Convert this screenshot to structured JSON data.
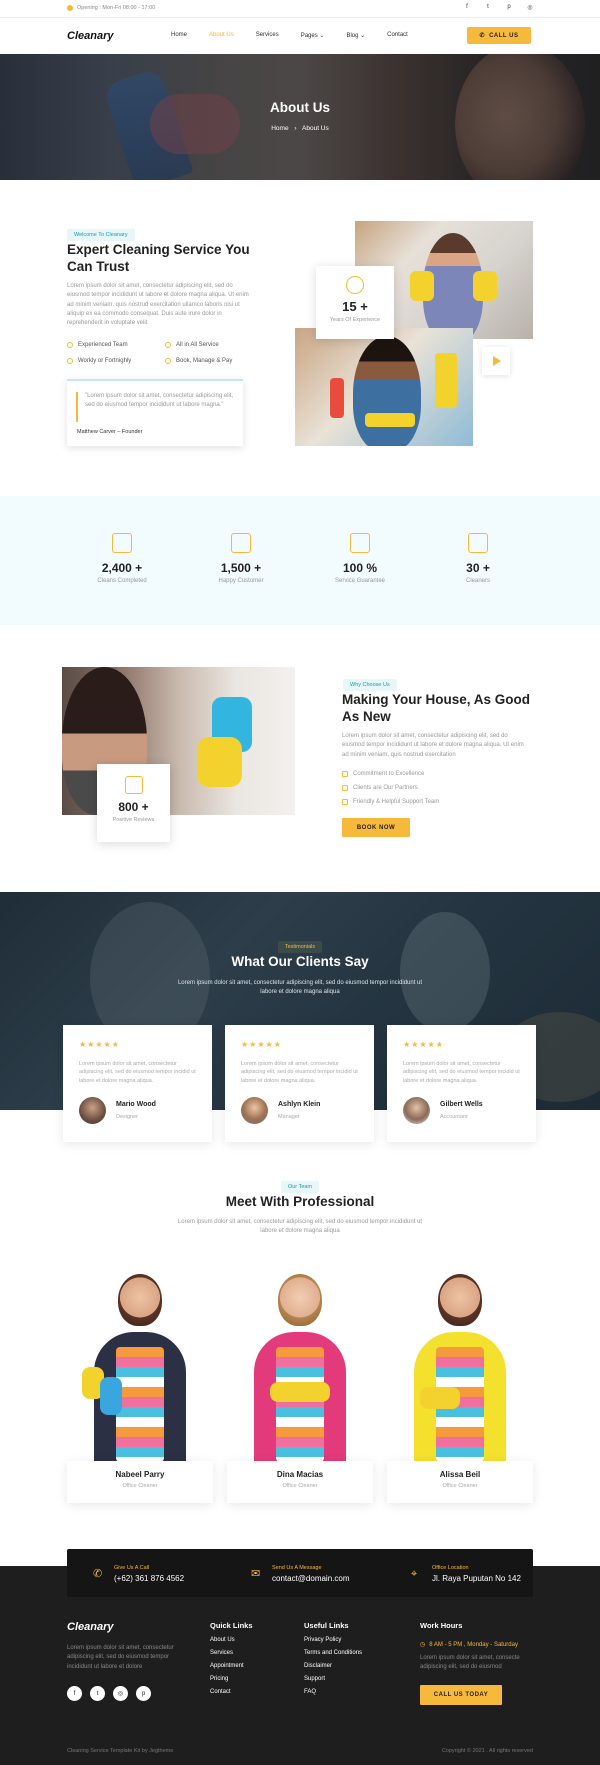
{
  "topbar": {
    "opening": "Opening : Mon-Fri 08:00 - 17:00",
    "socials": [
      "f",
      "t",
      "p",
      "◎"
    ]
  },
  "nav": {
    "logo": "Cleanary",
    "menu": [
      "Home",
      "About Us",
      "Services",
      "Pages ⌄",
      "Blog ⌄",
      "Contact"
    ],
    "call": "CALL US"
  },
  "hero": {
    "title": "About Us",
    "crumb_home": "Home",
    "crumb_sep": "›",
    "crumb_current": "About Us"
  },
  "about": {
    "tag": "Welcome To Cleanary",
    "title": "Expert Cleaning Service You Can Trust",
    "para": "Lorem ipsum dolor sit amet, consectetur adipiscing elit, sed do eiusmod tempor incididunt ut labore et dolore magna aliqua. Ut enim ad minim veniam, quis nostrud exercitation ullamco laboris nisi ut aliquip ex ea commodo consequat. Duis aute irure dolor in reprehenderit in voluptate velit",
    "features": [
      "Experienced Team",
      "All in All Service",
      "Workly or Fortnighly",
      "Book, Manage & Pay"
    ],
    "quote": "\"Lorem ipsum dolor sit amet, consectetur adipiscing elit, sed do eiusmod tempor incididunt ut labore magna.\"",
    "author": "Matthew Carver – Founder",
    "years_num": "15 +",
    "years_label": "Years Of Experience"
  },
  "stats": [
    {
      "num": "2,400 +",
      "label": "Cleans Completed"
    },
    {
      "num": "1,500 +",
      "label": "Happy Customer"
    },
    {
      "num": "100 %",
      "label": "Service Guarantee"
    },
    {
      "num": "30 +",
      "label": "Cleaners"
    }
  ],
  "why": {
    "tag": "Why Choose Us",
    "title": "Making Your House, As Good As New",
    "para": "Lorem ipsum dolor sit amet, consectetur adipiscing elit, sed do eiusmod tempor incididunt ut labore et dolore magna aliqua. Ut enim ad minim veniam, quis nostrud exercitation",
    "checks": [
      "Commitment to Excellence",
      "Clients are Our Partners",
      "Friendly & Helpful Support Team"
    ],
    "button": "BOOK NOW",
    "reviews_num": "800 +",
    "reviews_label": "Positive Reviews"
  },
  "testimonials": {
    "tag": "Testimonials",
    "title": "What Our Clients Say",
    "para": "Lorem ipsum dolor sit amet, consectetur adipiscing elit, sed do eiusmod tempor incididunt ut labore et dolore magna aliqua",
    "stars": "★★★★★",
    "items": [
      {
        "text": "Lorem ipsum dolor sit amet, consectetur adipiscing elit, sed do eiusmod tempor incidid ut labore et dolore magna aliqua.",
        "name": "Mario Wood",
        "role": "Designer"
      },
      {
        "text": "Lorem ipsum dolor sit amet, consectetur adipiscing elit, sed do eiusmod tempor incidid ut labore et dolore magna aliqua.",
        "name": "Ashlyn Klein",
        "role": "Manager"
      },
      {
        "text": "Lorem ipsum dolor sit amet, consectetur adipiscing elit, sed do eiusmod tempor incidid ut labore et dolore magna aliqua.",
        "name": "Gilbert Wells",
        "role": "Accountant"
      }
    ]
  },
  "team": {
    "tag": "Our Team",
    "title": "Meet With Professional",
    "para": "Lorem ipsum dolor sit amet, consectetur adipiscing elit, sed do eiusmod tempor incididunt ut labore et dolore magna aliqua",
    "members": [
      {
        "name": "Nabeel Parry",
        "role": "Office Cleaner"
      },
      {
        "name": "Dina Macias",
        "role": "Office Cleaner"
      },
      {
        "name": "Alissa Beil",
        "role": "Office Cleaner"
      }
    ]
  },
  "contact": [
    {
      "label": "Give Us A Call",
      "value": "(+62) 361 876 4562"
    },
    {
      "label": "Send Us A Message",
      "value": "contact@domain.com"
    },
    {
      "label": "Office Location",
      "value": "Jl. Raya Puputan No 142"
    }
  ],
  "footer": {
    "logo": "Cleanary",
    "para": "Lorem ipsum dolor sit amet, consectetur adipiscing elit, sed do eiusmod tempor incididunt ut labore et dolore",
    "quick_title": "Quick Links",
    "quick": [
      "About Us",
      "Services",
      "Appointment",
      "Pricing",
      "Contact"
    ],
    "useful_title": "Useful Links",
    "useful": [
      "Privacy Policy",
      "Terms and Conditions",
      "Disclaimer",
      "Support",
      "FAQ"
    ],
    "hours_title": "Work Hours",
    "hours": "8 AM - 5 PM , Monday - Saturday",
    "hours_para": "Lorem ipsum dolor sit amet, consecte adipiscing elit, sed do eiusmod",
    "call_today": "CALL US TODAY",
    "credit": "Cleaning Service Template Kit by Jegtheme",
    "copyright": "Copyright © 2021 . All rights reserved"
  },
  "colors": {
    "accent": "#f6b93b",
    "teal": "#1a9bb0",
    "dark": "#1e1e1e"
  }
}
